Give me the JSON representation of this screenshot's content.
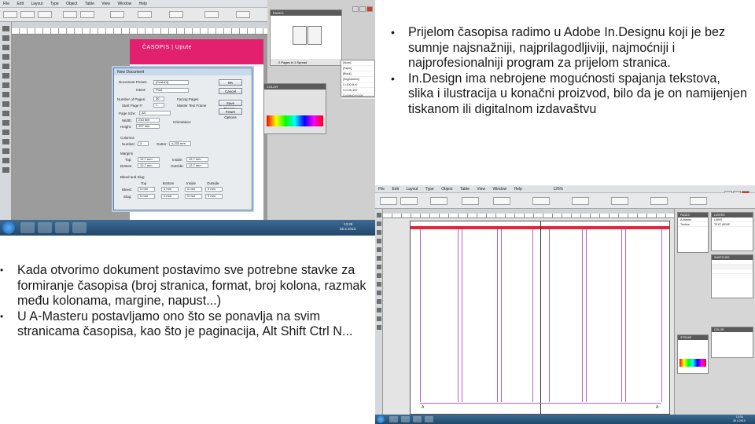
{
  "slide": {
    "top_bullets": [
      "Prijelom časopisa radimo u Adobe In.Designu koji  je bez sumnje najsnažniji, najprilagodljiviji, najmoćniji i najprofesionalniji program za prijelom stranica.",
      "In.Design ima nebrojene mogućnosti spajanja tekstova, slika i ilustracija u konačni proizvod, bilo da je on namijenjen tiskanom ili digitalnom izdavaštvu"
    ],
    "bottom_bullets": [
      "Kada otvorimo dokument postavimo sve potrebne stavke za formiranje časopisa (broj stranica, format, broj kolona, razmak među kolonama, margine, napust...)",
      "U A-Masteru postavljamo ono što se ponavlja na svim stranicama časopisa, kao što je paginacija, Alt Shift Ctrl N..."
    ]
  },
  "screenshot1": {
    "menu": [
      "File",
      "Edit",
      "Layout",
      "Type",
      "Object",
      "Table",
      "View",
      "Window",
      "Help"
    ],
    "page_banner": "ČASOPIS  |  Upute",
    "dialog": {
      "title": "New Document",
      "document_preset_label": "Document Preset:",
      "document_preset_value": "[Custom]",
      "intent_label": "Intent:",
      "intent_value": "Print",
      "number_of_pages_label": "Number of Pages:",
      "number_of_pages_value": "30",
      "facing_pages_label": "Facing Pages",
      "start_page_label": "Start Page #:",
      "start_page_value": "1",
      "master_text_frame_label": "Master Text Frame",
      "page_size_label": "Page Size:",
      "page_size_value": "A4",
      "width_label": "Width:",
      "width_value": "210 mm",
      "height_label": "Height:",
      "height_value": "297 mm",
      "orientation_label": "Orientation:",
      "columns_label": "Columns",
      "number_label": "Number:",
      "number_value": "3",
      "gutter_label": "Gutter:",
      "gutter_value": "4,233 mm",
      "margins_label": "Margins",
      "top_label": "Top:",
      "top_value": "12,7 mm",
      "bottom_label": "Bottom:",
      "bottom_value": "12,7 mm",
      "inside_label": "Inside:",
      "inside_value": "12,7 mm",
      "outside_label": "Outside:",
      "outside_value": "12,7 mm",
      "bleed_label": "Bleed and Slug",
      "bleed_cols": [
        "Top",
        "Bottom",
        "Inside",
        "Outside"
      ],
      "bleed_row_label": "Bleed:",
      "bleed_values": [
        "0 mm",
        "0 mm",
        "0 mm",
        "0 mm"
      ],
      "slug_row_label": "Slug:",
      "slug_values": [
        "0 mm",
        "0 mm",
        "0 mm",
        "0 mm"
      ],
      "ok_label": "OK",
      "cancel_label": "Cancel",
      "save_preset_label": "Save Preset...",
      "more_options_label": "Fewer Options"
    },
    "pages_panel": {
      "title": "PAGES",
      "footer": "2 Pages in 1 Spread"
    },
    "color_panel": {
      "title": "COLOR"
    },
    "swatches": [
      "[None]",
      "[Paper]",
      "[Black]",
      "[Registration]",
      "C=100 M=0",
      "C=0 M=100",
      "C=0 M=0 Y=100"
    ],
    "clock": {
      "time": "13:25",
      "date": "26.4.2013."
    }
  },
  "screenshot2": {
    "menu": [
      "File",
      "Edit",
      "Layout",
      "Type",
      "Object",
      "Table",
      "View",
      "Window",
      "Help"
    ],
    "zoom": "125%",
    "panels": {
      "pages_title": "PAGES",
      "layers_title": "LAYERS",
      "master_label": "A-Master",
      "master_value": "Tredina",
      "links_title": "LINKS",
      "text_wrap_label": "TEXT WRAP",
      "stroke_title": "STROKE",
      "swatches_title": "SWATCHES",
      "color_title": "COLOR"
    },
    "page_left": "A",
    "page_right": "A",
    "clock": {
      "time": "13:34",
      "date": "26.4.2013."
    }
  }
}
